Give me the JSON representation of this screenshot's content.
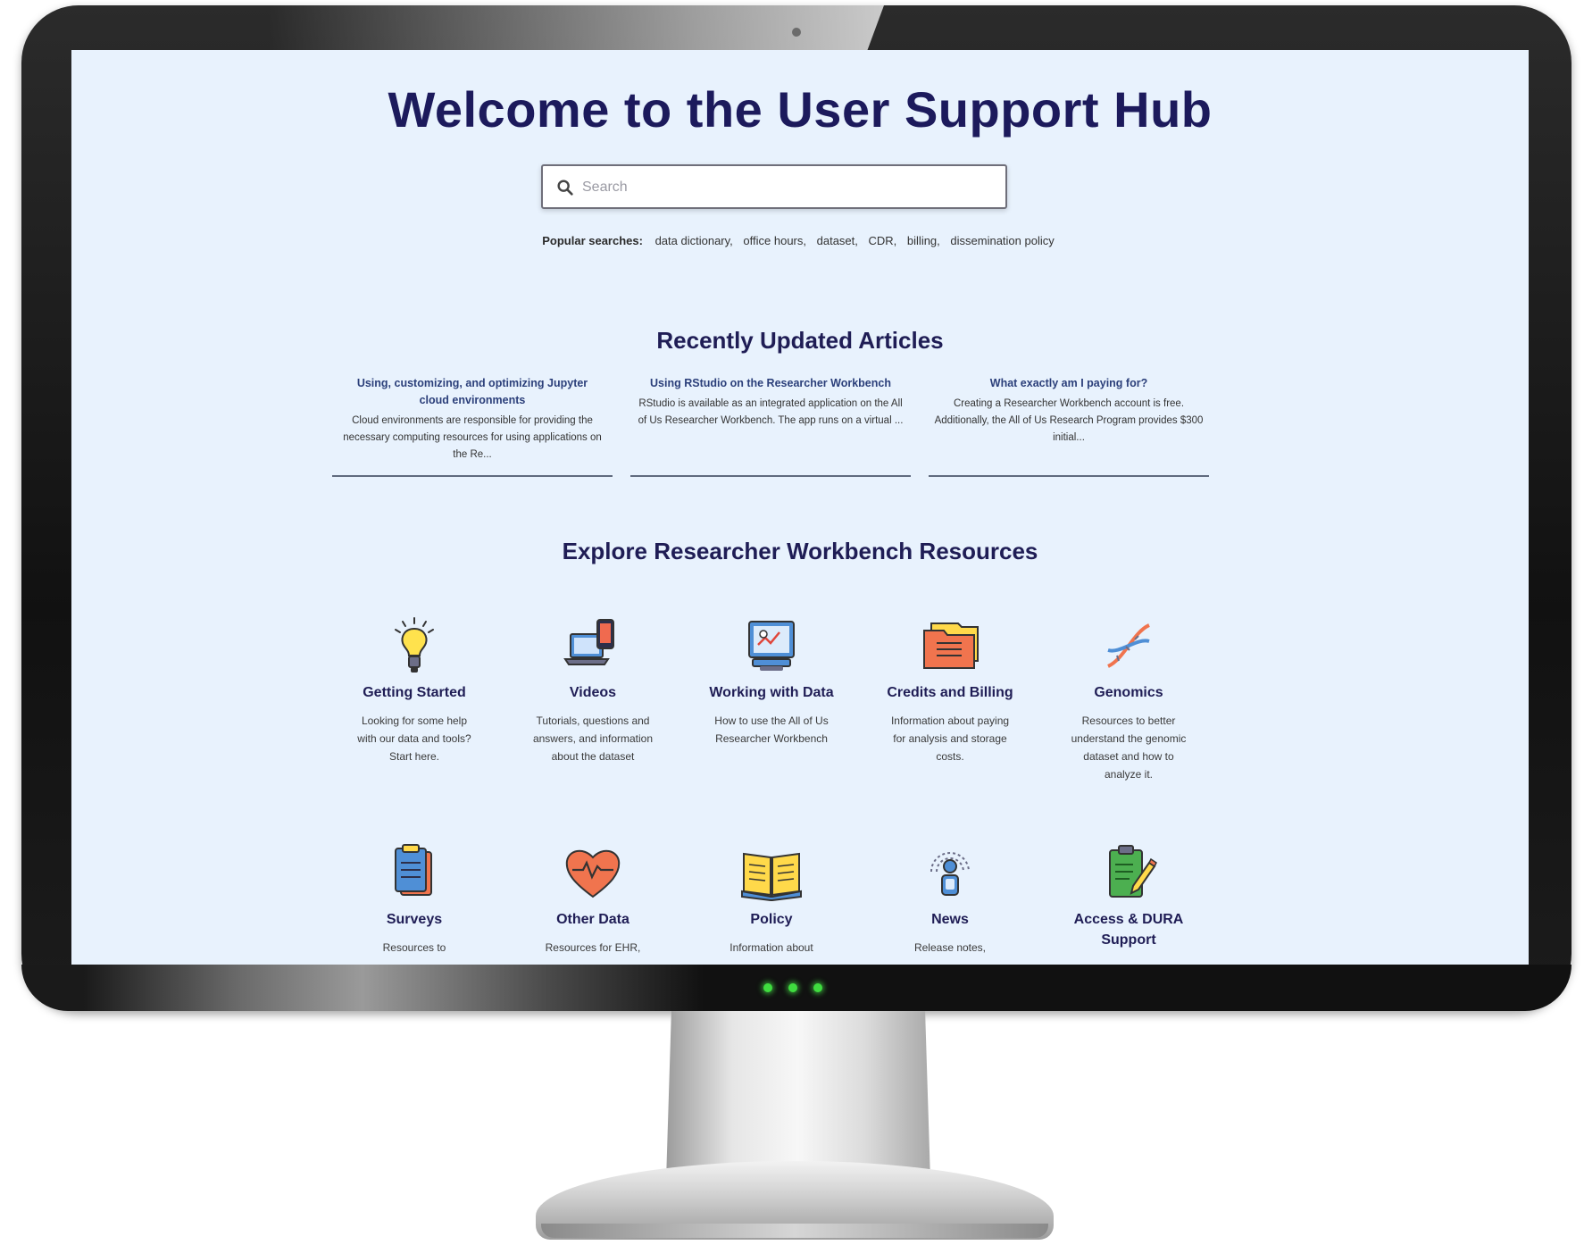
{
  "hub": {
    "title": "Welcome to the User Support Hub",
    "search": {
      "placeholder": "Search"
    },
    "popular": {
      "label": "Popular searches:",
      "terms": [
        "data dictionary,",
        "office hours,",
        "dataset,",
        "CDR,",
        "billing,",
        "dissemination policy"
      ]
    }
  },
  "recent": {
    "title": "Recently Updated Articles",
    "articles": [
      {
        "title": "Using, customizing, and optimizing Jupyter cloud environments",
        "desc": "Cloud environments are responsible for providing the necessary computing resources for using applications on the Re..."
      },
      {
        "title": "Using RStudio on the Researcher Workbench",
        "desc": "RStudio is available as an integrated application on the All of Us Researcher Workbench. The app runs on a virtual ..."
      },
      {
        "title": "What exactly am I paying for?",
        "desc": "Creating a Researcher Workbench account is free. Additionally, the All of Us Research Program provides $300 initial..."
      }
    ]
  },
  "explore": {
    "title": "Explore Researcher Workbench Resources",
    "resources": [
      {
        "name": "Getting Started",
        "desc": "Looking for some help with our data and tools? Start here.",
        "icon": "lightbulb-icon"
      },
      {
        "name": "Videos",
        "desc": "Tutorials, questions and answers, and information about the dataset",
        "icon": "laptop-phone-icon"
      },
      {
        "name": "Working with Data",
        "desc": "How to use the All of Us Researcher Workbench",
        "icon": "monitor-chart-icon"
      },
      {
        "name": "Credits and Billing",
        "desc": "Information about paying for analysis and storage costs.",
        "icon": "folder-icon"
      },
      {
        "name": "Genomics",
        "desc": "Resources to better understand the genomic dataset and how to analyze it.",
        "icon": "dna-icon"
      },
      {
        "name": "Surveys",
        "desc": "Resources to",
        "icon": "clipboard-icon"
      },
      {
        "name": "Other Data",
        "desc": "Resources for EHR,",
        "icon": "heart-icon"
      },
      {
        "name": "Policy",
        "desc": "Information about",
        "icon": "book-icon"
      },
      {
        "name": "News",
        "desc": "Release notes,",
        "icon": "broadcast-icon"
      },
      {
        "name": "Access & DURA Support",
        "desc": "",
        "icon": "clipboard-pencil-icon"
      }
    ]
  }
}
